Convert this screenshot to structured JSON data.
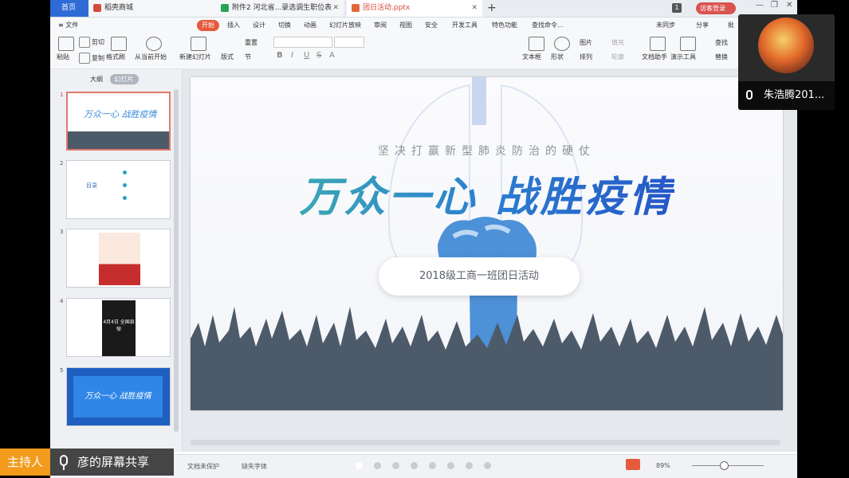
{
  "tabs": [
    {
      "label": "首页",
      "active": false
    },
    {
      "label": "稻壳商城",
      "active": false
    },
    {
      "label": "附件2 河北省...录选调生职位表",
      "active": false
    },
    {
      "label": "团日活动.pptx",
      "active": true
    }
  ],
  "titlebar": {
    "page_badge": "1",
    "login_label": "访客登录"
  },
  "menu": [
    "≡ 文件",
    "开始",
    "插入",
    "设计",
    "切换",
    "动画",
    "幻灯片放映",
    "审阅",
    "视图",
    "安全",
    "开发工具",
    "特色功能",
    "查找命令...",
    "未同步",
    "分享",
    "批"
  ],
  "ribbon": {
    "paste": "粘贴",
    "cut": "剪切",
    "copy": "复制",
    "format_painter": "格式刷",
    "from_current": "从当前开始",
    "new_slide": "新建幻灯片",
    "layout": "版式",
    "reset": "重置",
    "section": "节",
    "textbox": "文本框",
    "shape": "形状",
    "picture": "图片",
    "arrange": "排列",
    "fill": "填充",
    "outline": "轮廓",
    "doc_helper": "文档助手",
    "present_tools": "演示工具",
    "find": "查找",
    "replace": "替换"
  },
  "left_panel": {
    "tab_outline": "大纲",
    "tab_slides": "幻灯片",
    "thumbs": [
      {
        "num": "1",
        "title": "万众一心 战胜疫情"
      },
      {
        "num": "2",
        "title": "目录"
      },
      {
        "num": "3",
        "title": ""
      },
      {
        "num": "4",
        "title": "4月4日 全国哀悼"
      },
      {
        "num": "5",
        "title": "万众一心 战胜疫情"
      }
    ]
  },
  "slide": {
    "subtitle": "坚决打赢新型肺炎防治的硬仗",
    "title": "万众一心 战胜疫情",
    "pill_text": "2018级工商一班团日活动"
  },
  "status": {
    "doc_protect": "文档未保护",
    "missing_font": "缺失字体",
    "zoom": "89%"
  },
  "overlay": {
    "host_label": "主持人",
    "share_label": "彦的屏幕共享",
    "video_name": "朱浩腾201..."
  },
  "colors": {
    "accent": "#e55a3c",
    "title_gradient_start": "#3aa7b5",
    "title_gradient_end": "#2557c7",
    "crowd": "#4d5a6a",
    "host_badge": "#f39b1c"
  }
}
